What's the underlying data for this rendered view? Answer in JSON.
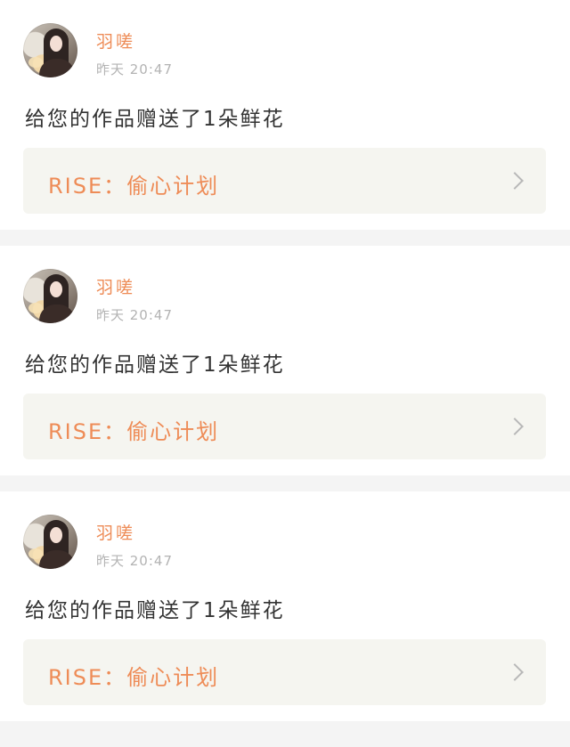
{
  "notifications": [
    {
      "username": "羽嗟",
      "time": "昨天 20:47",
      "message": "给您的作品赠送了1朵鲜花",
      "link_text": "RISE：偷心计划"
    },
    {
      "username": "羽嗟",
      "time": "昨天 20:47",
      "message": "给您的作品赠送了1朵鲜花",
      "link_text": "RISE：偷心计划"
    },
    {
      "username": "羽嗟",
      "time": "昨天 20:47",
      "message": "给您的作品赠送了1朵鲜花",
      "link_text": "RISE：偷心计划"
    }
  ],
  "icons": {
    "link_arrow": "chevron-right-icon",
    "avatar": "user-avatar"
  },
  "colors": {
    "accent": "#ee8c57",
    "tab_indicator": "#e56aa3",
    "timestamp": "#b3b3b3",
    "message": "#333333",
    "link_box_bg": "#f5f5f0",
    "page_bg": "#f4f4f4"
  }
}
